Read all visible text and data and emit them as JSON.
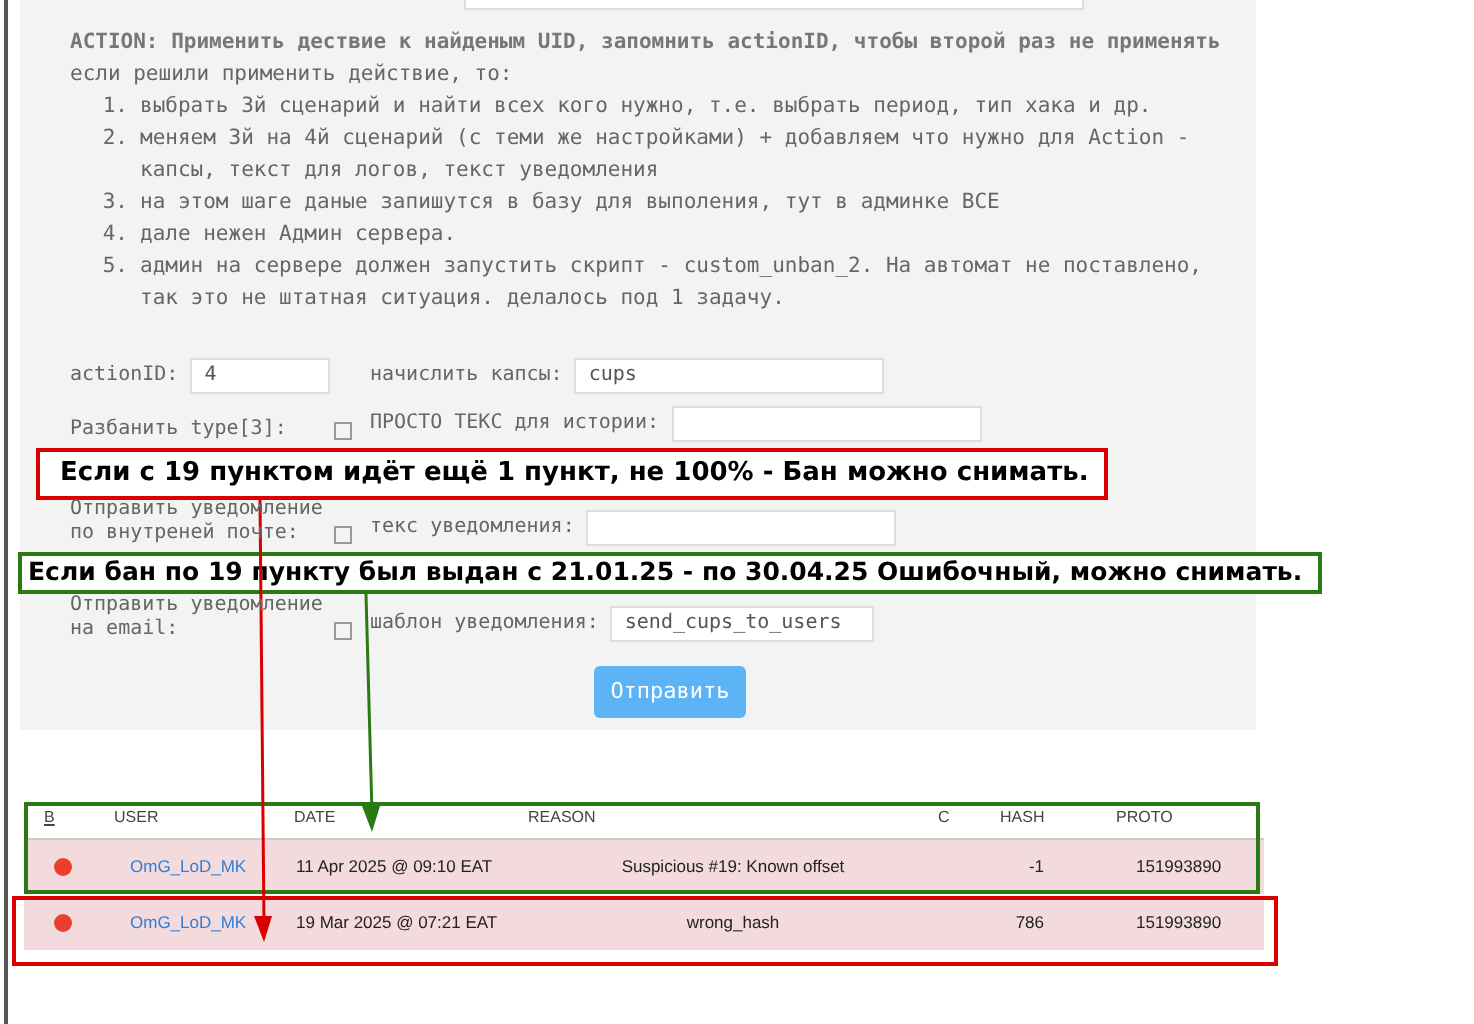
{
  "form": {
    "heading": "ACTION: Применить дествие к найденым UID, запомнить actionID, чтобы второй раз не применять",
    "intro": "если решили применить действие, то:",
    "steps": [
      {
        "number": "1.",
        "text": "выбрать 3й сценарий и найти всех кого нужно, т.е. выбрать период, тип хака и др."
      },
      {
        "number": "2.",
        "text": "меняем 3й на 4й сценарий (с теми же настройками) + добавляем что нужно для Action - капсы, текст для логов, текст уведомления"
      },
      {
        "number": "3.",
        "text": "на этом шаге даные запишутся в базу для выполения, тут в админке ВСЕ"
      },
      {
        "number": "4.",
        "text": "дале нежен Админ сервера."
      },
      {
        "number": "5.",
        "text": "админ на сервере должен запустить скрипт - custom_unban_2. На автомат не поставлено, так это не штатная ситуация. делалось под 1 задачу."
      }
    ],
    "rows": [
      {
        "left": {
          "kind": "text",
          "label": "actionID:",
          "value": "4"
        },
        "right": {
          "kind": "text",
          "label": "начислить капсы:",
          "value": "cups"
        }
      },
      {
        "left": {
          "kind": "checkbox",
          "label": "Разбанить type[3]:",
          "checked": false
        },
        "right": {
          "kind": "text",
          "label": "ПРОСТО ТЕКС для истории:"
        }
      },
      {
        "left": {
          "kind": "checkbox",
          "label": "Отправить уведомление по внутреней почте:",
          "checked": false
        },
        "right": {
          "kind": "text",
          "label": "текс уведомления:"
        }
      },
      {
        "left": {
          "kind": "checkbox",
          "label": "Отправить уведомление на email:",
          "checked": false
        },
        "right": {
          "kind": "text",
          "label": "шаблон уведомления:",
          "value": "send_cups_to_users"
        }
      }
    ],
    "submit": "Отправить"
  },
  "table": {
    "columns": [
      "B",
      "USER",
      "DATE",
      "REASON",
      "C",
      "HASH",
      "PROTO"
    ],
    "rows": [
      {
        "user": "OmG_LoD_MK",
        "date": "11 Apr 2025 @ 09:10 EAT",
        "reason": "Suspicious #19: Known offset",
        "hash": "-1",
        "proto": "151993890"
      },
      {
        "user": "OmG_LoD_MK",
        "date": "19 Mar 2025 @ 07:21 EAT",
        "reason": "wrong_hash",
        "hash": "786",
        "proto": "151993890"
      }
    ]
  },
  "annotations": [
    {
      "text": "Если с 19 пунктом идёт ещё 1 пункт, не 100% - Бан можно снимать.",
      "color": "#d90000"
    },
    {
      "text": "Если бан по 19 пункту был выдан с 21.01.25 - по 30.04.25 Ошибочный, можно снимать.",
      "color": "#2a7a14"
    }
  ]
}
